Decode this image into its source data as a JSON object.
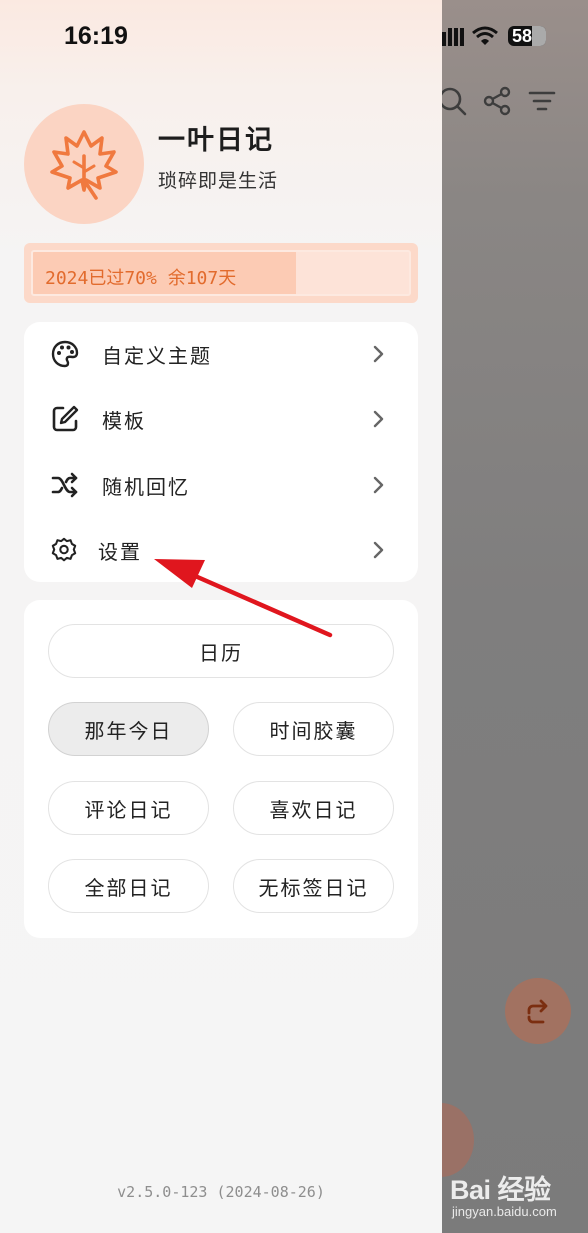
{
  "status_bar": {
    "time": "16:19",
    "battery": "58"
  },
  "drawer": {
    "app_title": "一叶日记",
    "app_slogan": "琐碎即是生活",
    "progress": {
      "text": "2024已过70% 余107天",
      "fraction": 0.7
    },
    "menu": [
      {
        "label": "自定义主题",
        "icon": "palette-icon"
      },
      {
        "label": "模板",
        "icon": "edit-icon"
      },
      {
        "label": "随机回忆",
        "icon": "shuffle-icon"
      },
      {
        "label": "设置",
        "icon": "gear-icon"
      }
    ],
    "buttons": {
      "calendar": "日历",
      "on_this_day": "那年今日",
      "time_capsule": "时间胶囊",
      "commented": "评论日记",
      "liked": "喜欢日记",
      "all": "全部日记",
      "untagged": "无标签日记"
    },
    "version": "v2.5.0-123 (2024-08-26)"
  },
  "watermark": {
    "brand": "Bai 经验",
    "url": "jingyan.baidu.com"
  },
  "colors": {
    "accent": "#f0793f",
    "avatar_bg": "#fbd4c3",
    "arrow": "#e0161e"
  }
}
